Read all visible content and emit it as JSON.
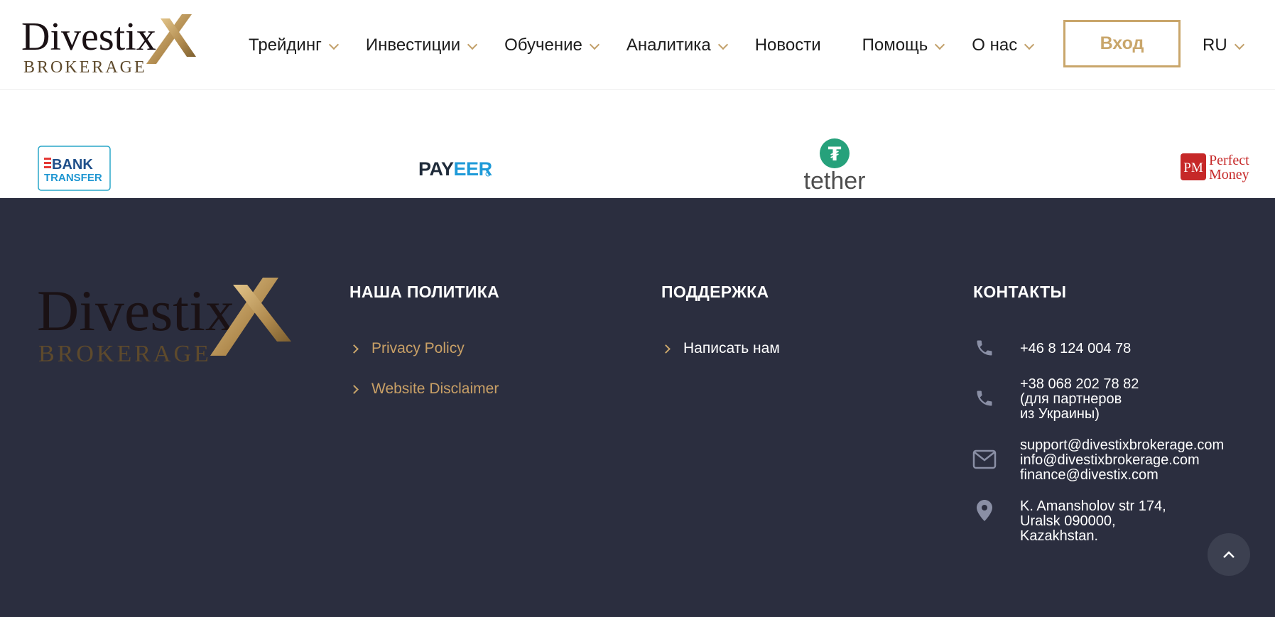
{
  "brand": {
    "name": "Divestix",
    "sub": "BROKERAGE",
    "mark": "X",
    "dark": "#1a1114",
    "gold": "#b08a4e"
  },
  "nav": {
    "items": [
      {
        "label": "Трейдинг",
        "has_dropdown": true
      },
      {
        "label": "Инвестиции",
        "has_dropdown": true
      },
      {
        "label": "Обучение",
        "has_dropdown": true
      },
      {
        "label": "Аналитика",
        "has_dropdown": true
      },
      {
        "label": "Новости",
        "has_dropdown": false
      },
      {
        "label": "Помощь",
        "has_dropdown": true
      },
      {
        "label": "О нас",
        "has_dropdown": true
      }
    ],
    "login_label": "Вход",
    "language": "RU"
  },
  "payments": {
    "bank_transfer": {
      "line1": "BANK",
      "line2": "TRANSFER"
    },
    "payeer": {
      "part1": "PAY",
      "part2": "EER"
    },
    "tether": {
      "label": "tether",
      "symbol": "₮"
    },
    "perfect_money": {
      "badge": "PM",
      "line1": "Perfect",
      "line2": "Money"
    }
  },
  "footer": {
    "policy": {
      "title": "НАША ПОЛИТИКА",
      "links": [
        "Privacy Policy",
        "Website Disclaimer"
      ]
    },
    "support": {
      "title": "ПОДДЕРЖКА",
      "links": [
        "Написать нам"
      ]
    },
    "contacts": {
      "title": "КОНТАКТЫ",
      "phone1": "+46 8 124 004 78",
      "phone2": {
        "number": "+38 068 202 78 82",
        "note1": "(для партнеров",
        "note2": "из Украины)"
      },
      "emails": [
        "support@divestixbrokerage.com",
        "info@divestixbrokerage.com",
        "finance@divestix.com"
      ],
      "address": [
        "K. Amansholov str 174,",
        "Uralsk 090000,",
        "Kazakhstan."
      ]
    }
  },
  "colors": {
    "accent_gold": "#c9a66b",
    "footer_bg": "#2b2e3f",
    "icon_gray": "#8a8fa5"
  }
}
